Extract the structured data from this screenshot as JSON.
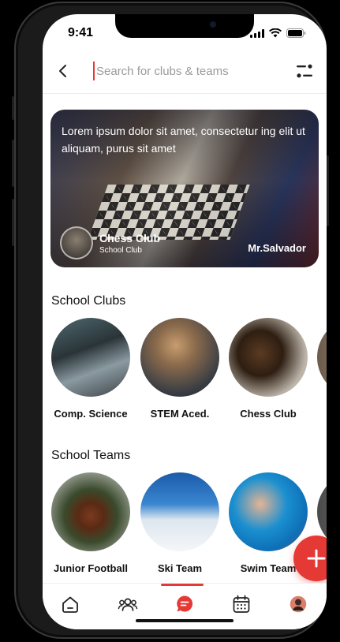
{
  "status_bar": {
    "time": "9:41"
  },
  "search": {
    "placeholder": "Search for clubs & teams",
    "value": ""
  },
  "featured": {
    "description": "Lorem ipsum dolor sit amet, consectetur ing elit ut aliquam, purus sit amet",
    "club_name": "Chess Club",
    "club_subtitle": "School Club",
    "coach": "Mr.Salvador"
  },
  "sections": {
    "clubs": {
      "title": "School Clubs",
      "items": [
        {
          "label": "Comp. Science",
          "icon": "laptop-hands-image"
        },
        {
          "label": "STEM Aced.",
          "icon": "student-robotics-image"
        },
        {
          "label": "Chess Club",
          "icon": "chess-pieces-image"
        }
      ]
    },
    "teams": {
      "title": "School Teams",
      "items": [
        {
          "label": "Junior Football",
          "icon": "football-image"
        },
        {
          "label": "Ski Team",
          "icon": "skier-image"
        },
        {
          "label": "Swim Team",
          "icon": "swimmer-image"
        }
      ]
    }
  },
  "tab_bar": {
    "items": [
      {
        "icon": "home-icon",
        "active": false
      },
      {
        "icon": "people-icon",
        "active": false
      },
      {
        "icon": "chat-icon",
        "active": true
      },
      {
        "icon": "calendar-icon",
        "active": false
      },
      {
        "icon": "profile-avatar",
        "active": false
      }
    ]
  },
  "colors": {
    "accent": "#e53935",
    "text": "#111111",
    "placeholder": "#9a9a9a"
  }
}
